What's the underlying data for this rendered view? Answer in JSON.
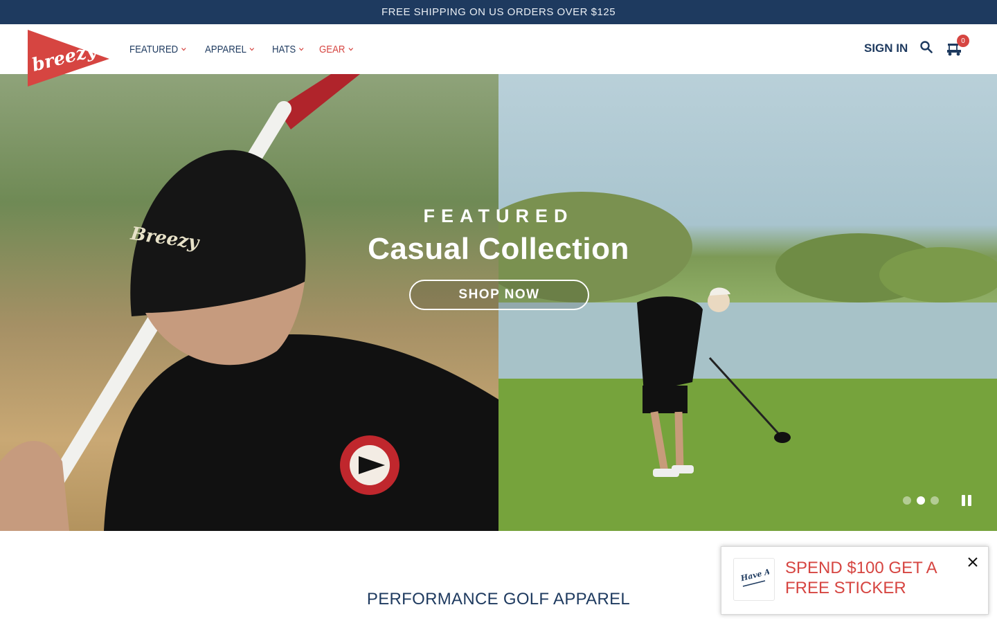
{
  "announcement": {
    "text": "FREE SHIPPING ON US ORDERS OVER $125"
  },
  "header": {
    "logo_text": "breezy",
    "nav": [
      {
        "label": "FEATURED",
        "color": "#1e3a5f"
      },
      {
        "label": "APPAREL",
        "color": "#1e3a5f"
      },
      {
        "label": "HATS",
        "color": "#1e3a5f"
      },
      {
        "label": "GEAR",
        "color": "#d64541"
      }
    ],
    "sign_in": "SIGN IN",
    "search_icon": "search-icon",
    "cart_icon": "golf-cart-icon",
    "cart_count": "0"
  },
  "hero": {
    "eyebrow": "FEATURED",
    "title": "Casual Collection",
    "cta": "SHOP NOW",
    "slides": 3,
    "active_slide": 2,
    "pause_icon": "pause-icon"
  },
  "section": {
    "title": "PERFORMANCE GOLF APPAREL"
  },
  "popup": {
    "text": "SPEND $100 GET A FREE STICKER",
    "sticker_text": "Have A Day",
    "close_icon": "close-icon"
  },
  "colors": {
    "navy": "#1e3a5f",
    "red": "#d64541",
    "white": "#ffffff"
  }
}
